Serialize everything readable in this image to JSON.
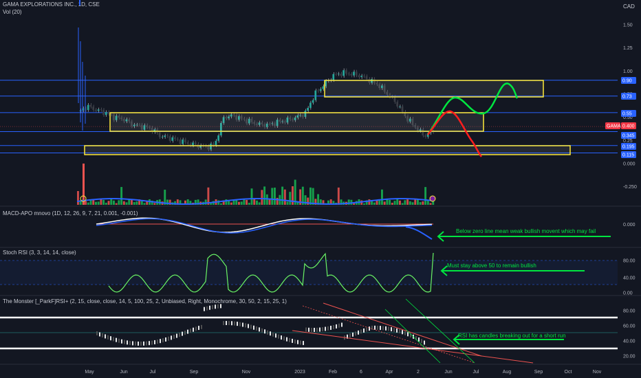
{
  "header": {
    "main_title": "GAMA EXPLORATIONS INC., 1D, CSE",
    "vol_label": "Vol (20)",
    "currency": "CAD"
  },
  "panes": {
    "macd_title": "MACD-APO mnovo (1D, 12, 26, 9, 7, 21, 0.001, -0.001)",
    "stoch_title": "Stoch RSI (3, 3, 14, 14, close)",
    "monster_title": "The Monster [_ParkF]RSI+ (2, 15, close, close, 14, 5, 100, 25, 2, Unbiased, Right, Monochrome, 30,  50, 2, 15,  25, 1)"
  },
  "price_axis": [
    "1.50",
    "1.25",
    "1.00",
    "0.75",
    "0.50",
    "0.25",
    "0.000",
    "-0.250"
  ],
  "price_badges": [
    {
      "label": "0.90",
      "color": "#2962ff"
    },
    {
      "label": "0.73",
      "color": "#2962ff"
    },
    {
      "label": "0.55",
      "color": "#2962ff"
    },
    {
      "label": "GAMA",
      "color": "#f23645"
    },
    {
      "label": "0.400",
      "color": "#f23645"
    },
    {
      "label": "0.345",
      "color": "#2962ff"
    },
    {
      "label": "0.195",
      "color": "#2962ff"
    },
    {
      "label": "0.115",
      "color": "#2962ff"
    }
  ],
  "macd_axis": [
    "0.000"
  ],
  "stoch_axis": [
    "80.00",
    "40.00",
    "0.00"
  ],
  "monster_axis": [
    "80.00",
    "60.00",
    "40.00",
    "20.00"
  ],
  "x_axis": [
    "May",
    "Jun",
    "Jul",
    "Sep",
    "Nov",
    "2023",
    "Feb",
    "6",
    "Apr",
    "2",
    "Jun",
    "Jul",
    "Aug",
    "Sep",
    "Oct",
    "Nov"
  ],
  "annotations": {
    "macd": "Below zero line mean weak bullish movent which may fail",
    "stoch": "Must stay above 50 to remain bullish",
    "monster": "RSI has candles breaking out for a short run"
  },
  "colors": {
    "background": "#131722",
    "up": "#26a69a",
    "down": "#ef5350",
    "zone": "#ffeb3b",
    "level_line": "#2962ff",
    "bull_path": "#00e640",
    "bear_path": "#ff1e1e",
    "annotation": "#00e640"
  },
  "chart_data": {
    "type": "candlestick",
    "price_close": [
      0.55,
      0.62,
      0.58,
      0.55,
      0.5,
      0.48,
      0.42,
      0.4,
      0.38,
      0.3,
      0.28,
      0.25,
      0.22,
      0.2,
      0.18,
      0.2,
      0.5,
      0.52,
      0.48,
      0.45,
      0.42,
      0.42,
      0.45,
      0.47,
      0.5,
      0.55,
      0.75,
      0.85,
      0.95,
      0.98,
      0.97,
      0.95,
      0.9,
      0.85,
      0.75,
      0.65,
      0.5,
      0.4,
      0.3,
      0.345
    ],
    "zones": [
      {
        "label": "resistance",
        "from": 0.73,
        "to": 0.9
      },
      {
        "label": "consolidation",
        "from": 0.345,
        "to": 0.55
      },
      {
        "label": "support",
        "from": 0.115,
        "to": 0.195
      }
    ],
    "ylim": [
      -0.35,
      1.6
    ]
  }
}
